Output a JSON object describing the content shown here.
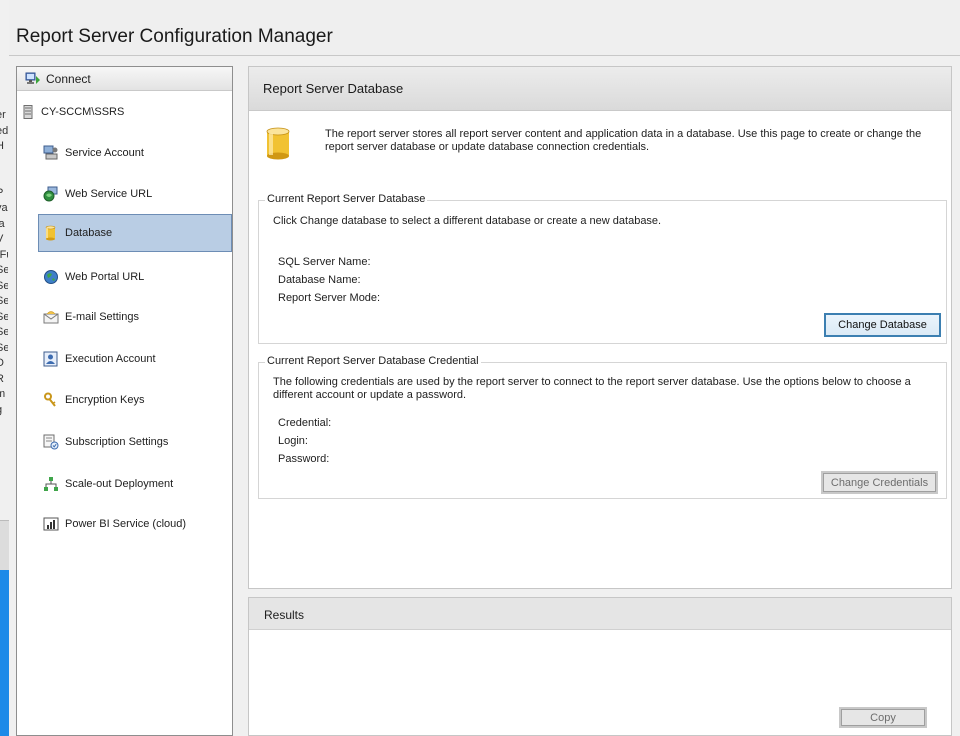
{
  "app": {
    "title": "Report Server Configuration Manager"
  },
  "background_window": {
    "fragments": [
      "er",
      "ed",
      "H",
      "t",
      "t",
      "P",
      "va",
      "ja",
      "V",
      "-Fu",
      "Se",
      "Se",
      "Se",
      "Se",
      "Se",
      "Se",
      "D",
      "R",
      "m",
      "g"
    ]
  },
  "nav": {
    "connect_label": "Connect",
    "server_name": "CY-SCCM\\SSRS",
    "items": [
      {
        "label": "Service Account",
        "icon": "service-account-icon"
      },
      {
        "label": "Web Service URL",
        "icon": "web-service-url-icon"
      },
      {
        "label": "Database",
        "icon": "database-icon",
        "selected": true
      },
      {
        "label": "Web Portal URL",
        "icon": "globe-icon"
      },
      {
        "label": "E-mail Settings",
        "icon": "email-icon"
      },
      {
        "label": "Execution Account",
        "icon": "execution-account-icon"
      },
      {
        "label": "Encryption Keys",
        "icon": "keys-icon"
      },
      {
        "label": "Subscription Settings",
        "icon": "subscription-icon"
      },
      {
        "label": "Scale-out Deployment",
        "icon": "scale-out-icon"
      },
      {
        "label": "Power BI Service (cloud)",
        "icon": "power-bi-icon"
      }
    ]
  },
  "main": {
    "title": "Report Server Database",
    "intro": "The report server stores all report server content and application data in a database. Use this page to create or change the report server database or update database connection credentials.",
    "current_db": {
      "title": "Current Report Server Database",
      "description": "Click Change database to select a different database or create a new database.",
      "sql_server_label": "SQL Server Name:",
      "database_name_label": "Database Name:",
      "mode_label": "Report Server Mode:",
      "button_label": "Change Database"
    },
    "credentials": {
      "title": "Current Report Server Database Credential",
      "description": "The following credentials are used by the report server to connect to the report server database.  Use the options below to choose a different account or update a password.",
      "credential_label": "Credential:",
      "login_label": "Login:",
      "password_label": "Password:",
      "button_label": "Change Credentials"
    }
  },
  "results": {
    "title": "Results",
    "copy_label": "Copy"
  },
  "colors": {
    "selected_bg": "#b9cde4",
    "selected_border": "#6d8db5",
    "focus_border": "#3c7fb1",
    "taskbar_blue": "#1d8ae8"
  }
}
